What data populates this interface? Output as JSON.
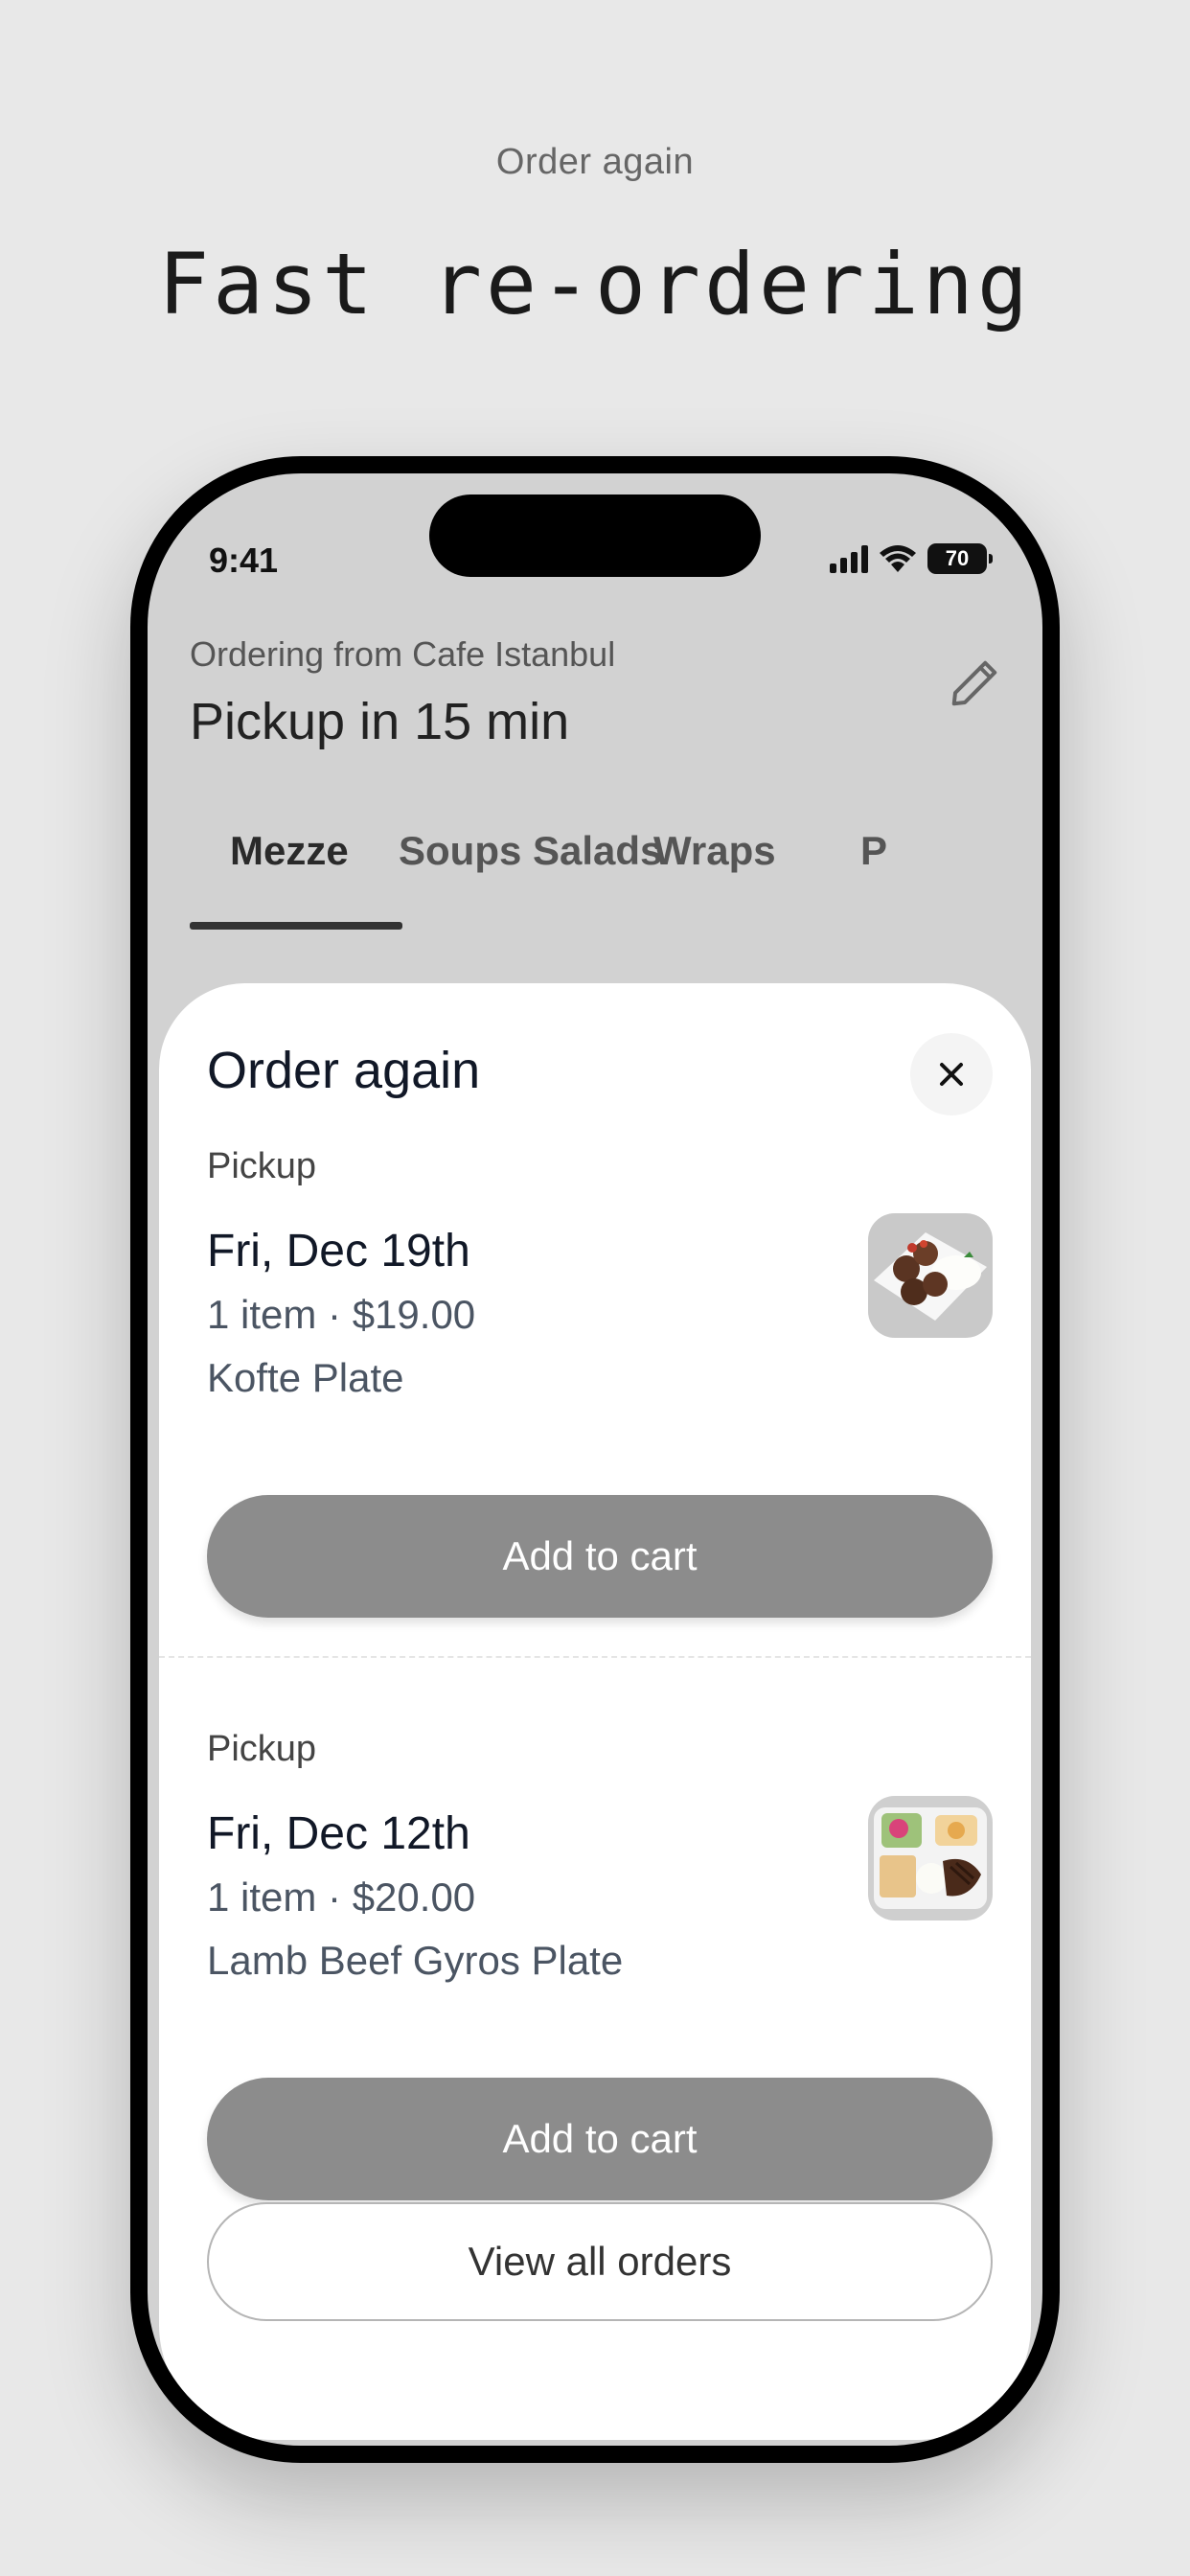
{
  "promo": {
    "subtitle": "Order again",
    "title": "Fast re-ordering"
  },
  "status_bar": {
    "time": "9:41",
    "battery": "70"
  },
  "header": {
    "ordering_from": "Ordering from Cafe Istanbul",
    "pickup_eta": "Pickup in 15 min",
    "edit_icon": "pencil-icon"
  },
  "tabs": [
    {
      "label": "Mezze",
      "active": true
    },
    {
      "label": "Soups Salads",
      "active": false
    },
    {
      "label": "Wraps",
      "active": false
    },
    {
      "label": "P",
      "active": false
    }
  ],
  "sheet": {
    "title": "Order again",
    "close_icon": "close-icon",
    "orders": [
      {
        "type": "Pickup",
        "date": "Fri, Dec 19th",
        "meta": "1 item · $19.00",
        "item": "Kofte Plate",
        "button": "Add to cart"
      },
      {
        "type": "Pickup",
        "date": "Fri, Dec 12th",
        "meta": "1 item · $20.00",
        "item": "Lamb Beef Gyros Plate",
        "button": "Add to cart"
      }
    ],
    "view_all": "View all orders"
  },
  "colors": {
    "button_gray": "#8c8c8c",
    "background": "#e8e8e8",
    "screen_bg": "#d2d2d2"
  }
}
